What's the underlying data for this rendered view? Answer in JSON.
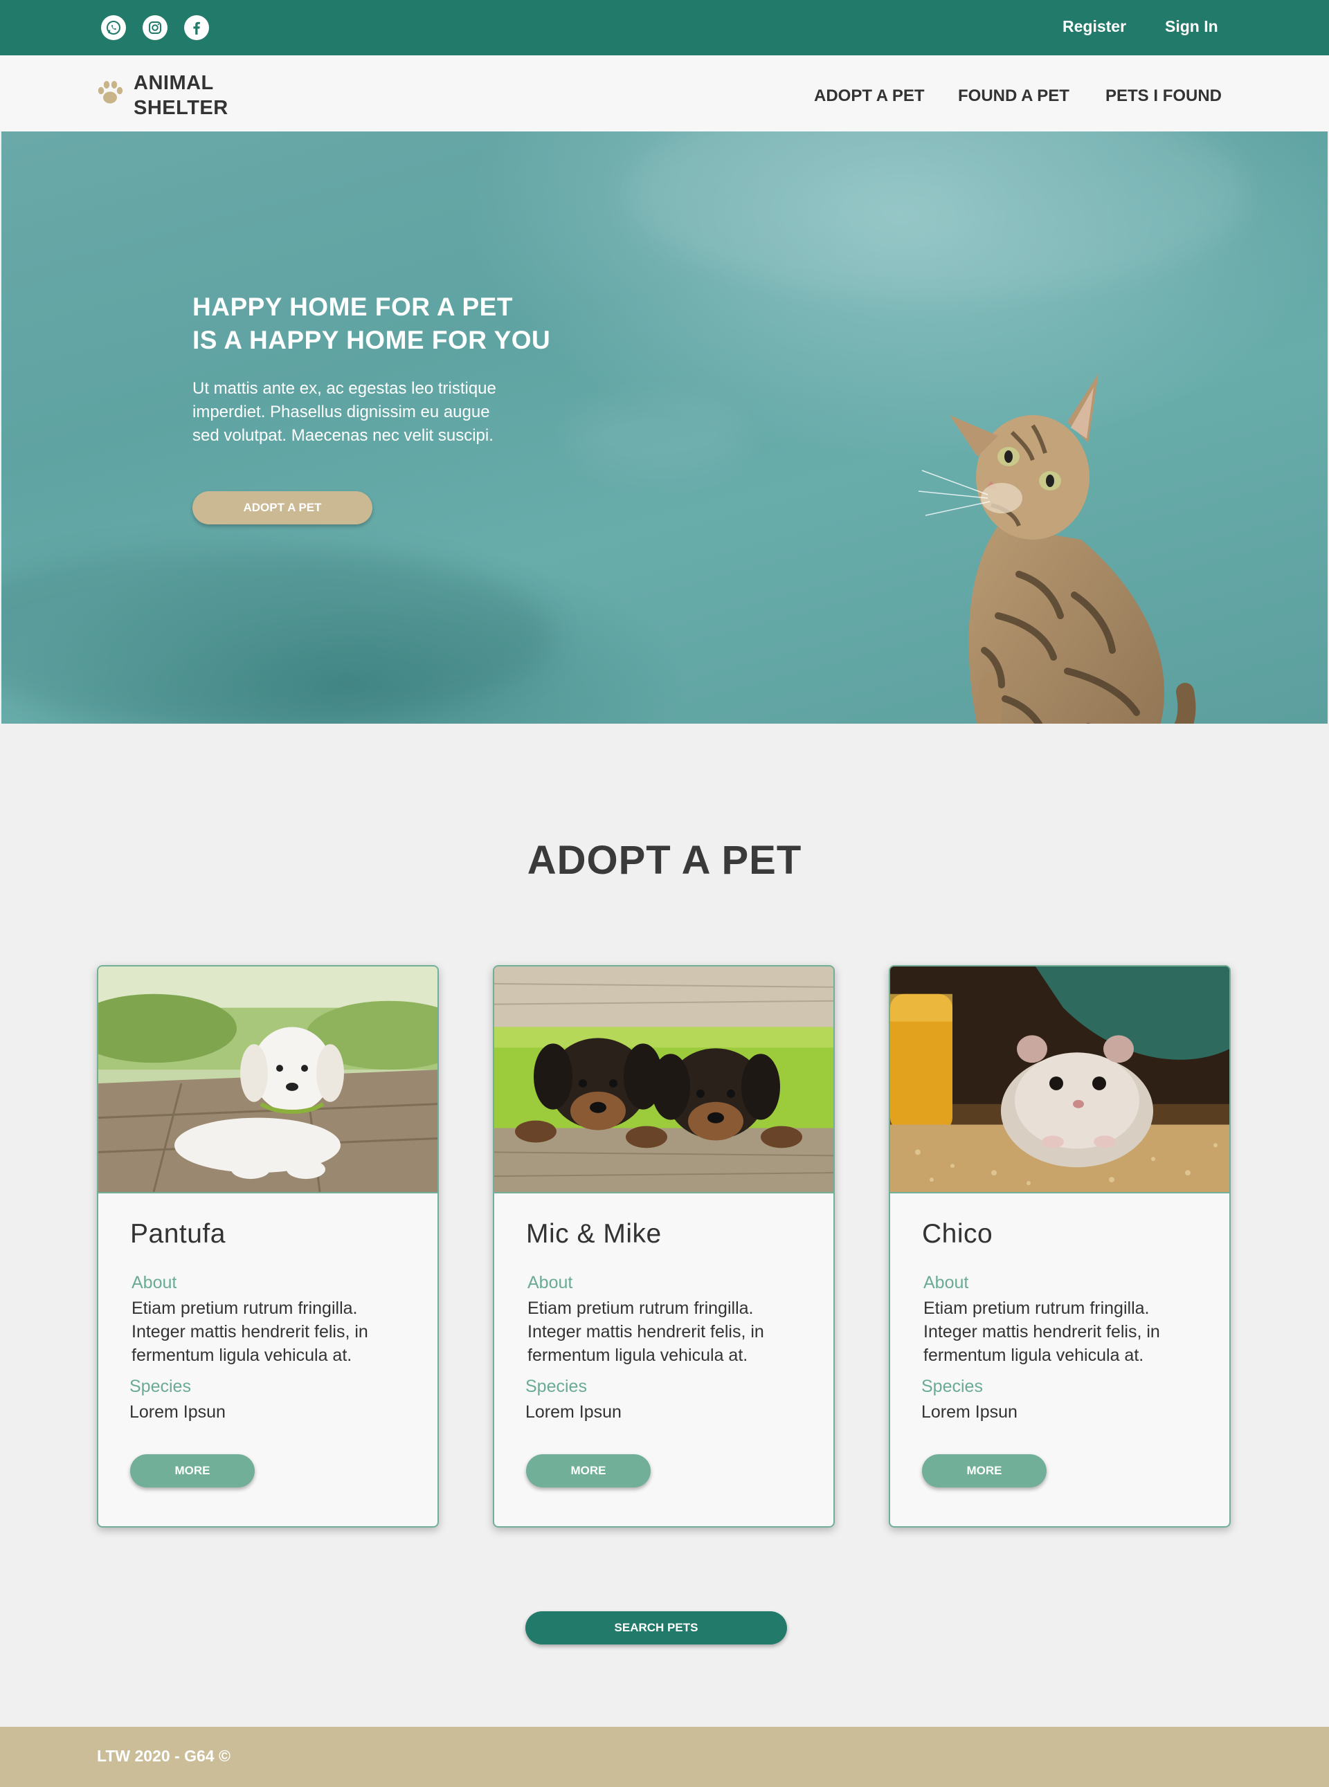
{
  "topbar": {
    "social_icons": [
      "whatsapp-icon",
      "instagram-icon",
      "facebook-icon"
    ],
    "register_label": "Register",
    "signin_label": "Sign In"
  },
  "nav": {
    "logo_line1": "ANIMAL",
    "logo_line2": "SHELTER",
    "logo_icon": "paw-icon",
    "items": [
      {
        "label": "ADOPT A PET"
      },
      {
        "label": "FOUND A PET"
      },
      {
        "label": "PETS I FOUND"
      }
    ]
  },
  "hero": {
    "title_line1": "HAPPY HOME FOR A PET",
    "title_line2": "IS A HAPPY HOME FOR YOU",
    "subtitle_line1": "Ut mattis ante ex, ac egestas leo tristique",
    "subtitle_line2": "imperdiet. Phasellus dignissim eu augue",
    "subtitle_line3": "sed volutpat. Maecenas nec velit suscipi.",
    "button_label": "ADOPT A PET"
  },
  "adopt": {
    "title": "ADOPT A PET",
    "cards": [
      {
        "name": "Pantufa",
        "about_label": "About",
        "about_line1": "Etiam pretium rutrum fringilla.",
        "about_line2": "Integer mattis hendrerit felis, in",
        "about_line3": "fermentum ligula vehicula at.",
        "species_label": "Species",
        "species_value": "Lorem Ipsun",
        "button_label": "MORE"
      },
      {
        "name": "Mic & Mike",
        "about_label": "About",
        "about_line1": "Etiam pretium rutrum fringilla.",
        "about_line2": "Integer mattis hendrerit felis, in",
        "about_line3": "fermentum ligula vehicula at.",
        "species_label": "Species",
        "species_value": "Lorem Ipsun",
        "button_label": "MORE"
      },
      {
        "name": "Chico",
        "about_label": "About",
        "about_line1": "Etiam pretium rutrum fringilla.",
        "about_line2": "Integer mattis hendrerit felis, in",
        "about_line3": "fermentum ligula vehicula at.",
        "species_label": "Species",
        "species_value": "Lorem Ipsun",
        "button_label": "MORE"
      }
    ],
    "search_button_label": "SEARCH PETS"
  },
  "footer": {
    "text": "LTW 2020 - G64 ©"
  },
  "colors": {
    "primary": "#227a6a",
    "accent": "#72af98",
    "sand": "#cbb993",
    "footer": "#cbbd98"
  }
}
